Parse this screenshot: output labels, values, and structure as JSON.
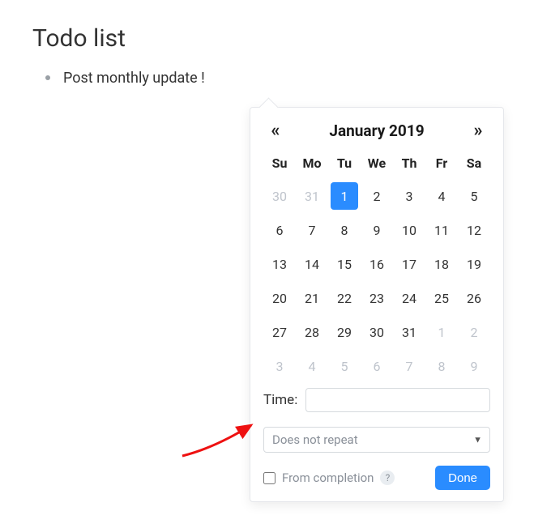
{
  "title": "Todo list",
  "todo_items": [
    {
      "text": "Post monthly update !"
    }
  ],
  "datepicker": {
    "prev_glyph": "«",
    "next_glyph": "»",
    "month_title": "January 2019",
    "weekdays": [
      "Su",
      "Mo",
      "Tu",
      "We",
      "Th",
      "Fr",
      "Sa"
    ],
    "days": [
      {
        "d": "30",
        "outside": true
      },
      {
        "d": "31",
        "outside": true
      },
      {
        "d": "1",
        "selected": true
      },
      {
        "d": "2"
      },
      {
        "d": "3"
      },
      {
        "d": "4"
      },
      {
        "d": "5"
      },
      {
        "d": "6"
      },
      {
        "d": "7"
      },
      {
        "d": "8"
      },
      {
        "d": "9"
      },
      {
        "d": "10"
      },
      {
        "d": "11"
      },
      {
        "d": "12"
      },
      {
        "d": "13"
      },
      {
        "d": "14"
      },
      {
        "d": "15"
      },
      {
        "d": "16"
      },
      {
        "d": "17"
      },
      {
        "d": "18"
      },
      {
        "d": "19"
      },
      {
        "d": "20"
      },
      {
        "d": "21"
      },
      {
        "d": "22"
      },
      {
        "d": "23"
      },
      {
        "d": "24"
      },
      {
        "d": "25"
      },
      {
        "d": "26"
      },
      {
        "d": "27"
      },
      {
        "d": "28"
      },
      {
        "d": "29"
      },
      {
        "d": "30"
      },
      {
        "d": "31"
      },
      {
        "d": "1",
        "outside": true
      },
      {
        "d": "2",
        "outside": true
      },
      {
        "d": "3",
        "outside": true
      },
      {
        "d": "4",
        "outside": true
      },
      {
        "d": "5",
        "outside": true
      },
      {
        "d": "6",
        "outside": true
      },
      {
        "d": "7",
        "outside": true
      },
      {
        "d": "8",
        "outside": true
      },
      {
        "d": "9",
        "outside": true
      }
    ],
    "time_label": "Time:",
    "time_value": "",
    "repeat_value": "Does not repeat",
    "from_completion_label": "From completion",
    "from_completion_checked": false,
    "help_glyph": "?",
    "done_label": "Done"
  },
  "colors": {
    "accent": "#2a8cff",
    "muted_text": "#8a9099"
  }
}
